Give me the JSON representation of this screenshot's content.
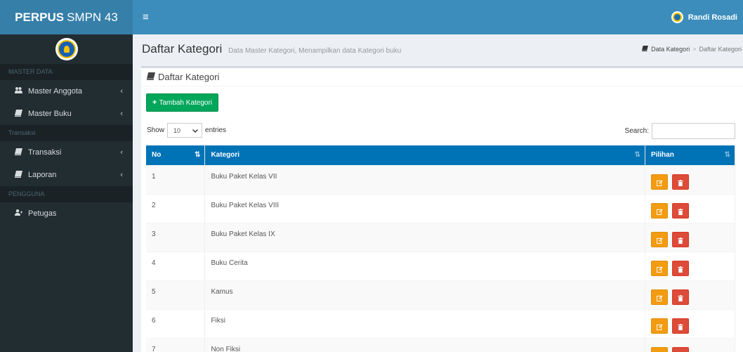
{
  "header": {
    "logo_bold": "PERPUS",
    "logo_rest": "SMPN 43",
    "toggle_icon": "≡",
    "user_name": "Randi Rosadi"
  },
  "sidebar": {
    "sections": [
      {
        "header": "MASTER DATA",
        "items": [
          {
            "label": "Master Anggota",
            "icon": "users-icon",
            "glyph": "👥",
            "chevron": "‹"
          },
          {
            "label": "Master Buku",
            "icon": "book-icon",
            "glyph": "📘",
            "chevron": "‹"
          }
        ]
      },
      {
        "header": "Transaksi",
        "items": [
          {
            "label": "Transaksi",
            "icon": "book-icon",
            "glyph": "📘",
            "chevron": "‹"
          },
          {
            "label": "Laporan",
            "icon": "book-icon",
            "glyph": "📘",
            "chevron": "‹"
          }
        ]
      },
      {
        "header": "PENGGUNA",
        "items": [
          {
            "label": "Petugas",
            "icon": "user-plus-icon",
            "glyph": "👤",
            "chevron": ""
          }
        ]
      }
    ]
  },
  "content_header": {
    "title": "Daftar Kategori",
    "subtitle": "Data Master Kategori, Menampilkan data Kategori buku",
    "breadcrumb": {
      "first": "Data Kategori",
      "separator": ">",
      "current": "Daftar Kategori"
    }
  },
  "box": {
    "title": "Daftar Kategori",
    "add_button": "Tambah Kategori",
    "show_label": "Show",
    "entries_value": "10",
    "entries_label": "entries",
    "search_label": "Search:"
  },
  "table": {
    "columns": [
      "No",
      "Kategori",
      "Pilihan"
    ],
    "rows": [
      {
        "no": "1",
        "kategori": "Buku Paket Kelas VII"
      },
      {
        "no": "2",
        "kategori": "Buku Paket Kelas VIII"
      },
      {
        "no": "3",
        "kategori": "Buku Paket Kelas IX"
      },
      {
        "no": "4",
        "kategori": "Buku Cerita"
      },
      {
        "no": "5",
        "kategori": "Kamus"
      },
      {
        "no": "6",
        "kategori": "Fiksi"
      },
      {
        "no": "7",
        "kategori": "Non Fiksi"
      }
    ]
  },
  "colors": {
    "header": "#3c8dbc",
    "logo_bg": "#367fa9",
    "sidebar": "#222d32",
    "table_header": "#0073b7",
    "success": "#00a65a",
    "warning": "#f39c12",
    "danger": "#dd4b39"
  }
}
